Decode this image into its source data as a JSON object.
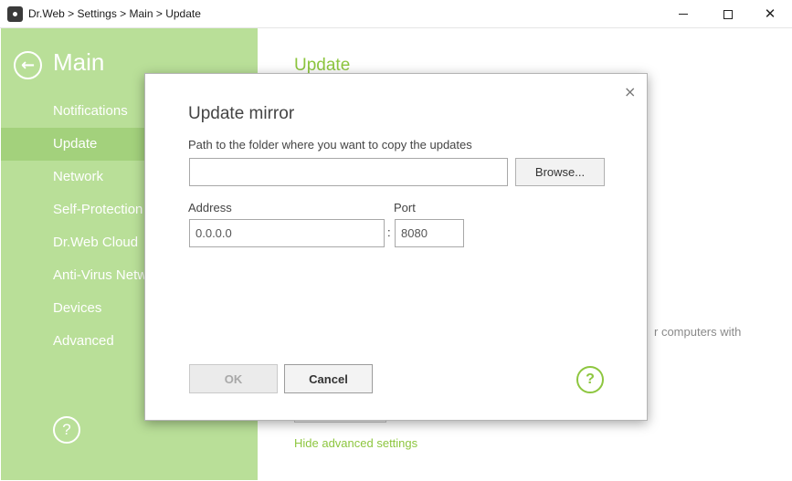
{
  "window": {
    "title": "Dr.Web > Settings > Main > Update",
    "app_icon": "drweb-spider-icon",
    "minimize_icon": "minimize-icon",
    "maximize_icon": "maximize-icon",
    "close_glyph": "✕"
  },
  "sidebar": {
    "back_glyph": "←",
    "title": "Main",
    "items": [
      {
        "label": "Notifications",
        "active": false
      },
      {
        "label": "Update",
        "active": true
      },
      {
        "label": "Network",
        "active": false
      },
      {
        "label": "Self-Protection",
        "active": false
      },
      {
        "label": "Dr.Web Cloud",
        "active": false
      },
      {
        "label": "Anti-Virus Network",
        "active": false
      },
      {
        "label": "Devices",
        "active": false
      },
      {
        "label": "Advanced",
        "active": false
      }
    ],
    "help_glyph": "?"
  },
  "main": {
    "title": "Update",
    "partial_text": "r computers with",
    "hide_link": "Hide advanced settings"
  },
  "dialog": {
    "title": "Update mirror",
    "close_glyph": "×",
    "path_label": "Path to the folder where you want to copy the updates",
    "path_value": "",
    "browse_label": "Browse...",
    "address_label": "Address",
    "address_value": "0.0.0.0",
    "colon": ":",
    "port_label": "Port",
    "port_value": "8080",
    "ok_label": "OK",
    "ok_enabled": false,
    "cancel_label": "Cancel",
    "help_glyph": "?"
  },
  "colors": {
    "sidebar_bg": "#b9df98",
    "sidebar_active": "#a3d17c",
    "accent_green": "#8dc63f"
  }
}
